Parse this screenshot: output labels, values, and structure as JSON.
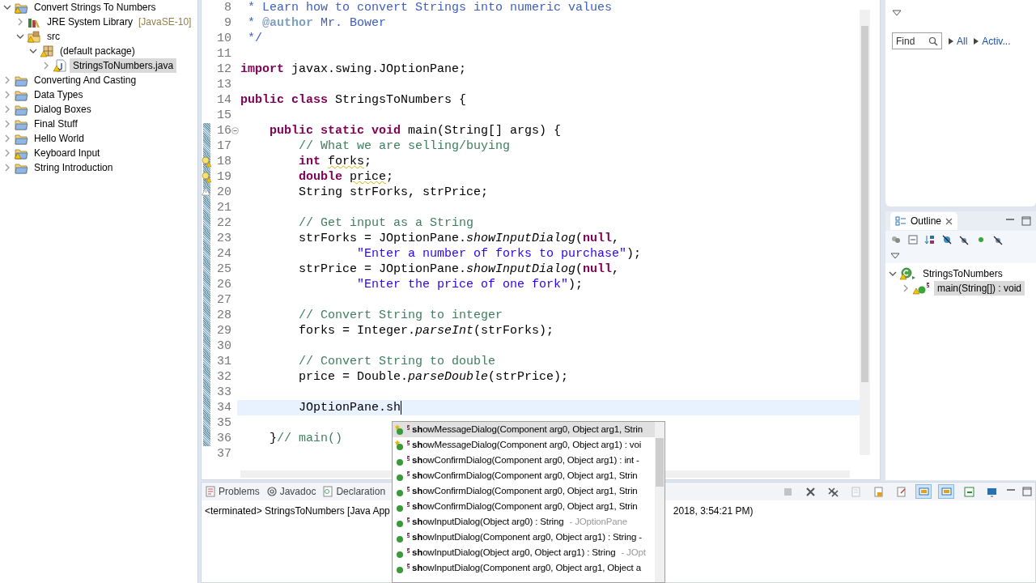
{
  "explorer": {
    "items": [
      {
        "label": "Convert Strings To Numbers",
        "kind": "project",
        "warning": true,
        "expanded": true,
        "selected": false,
        "children": [
          {
            "label": "JRE System Library",
            "decoration": "[JavaSE-10]",
            "kind": "library",
            "warning": false,
            "expanded": false,
            "selected": false
          },
          {
            "label": "src",
            "kind": "source-folder",
            "warning": true,
            "expanded": true,
            "selected": false,
            "children": [
              {
                "label": "(default package)",
                "kind": "package",
                "warning": true,
                "expanded": true,
                "selected": false,
                "children": [
                  {
                    "label": "StringsToNumbers.java",
                    "kind": "java-file",
                    "warning": true,
                    "expanded": false,
                    "selected": true
                  }
                ]
              }
            ]
          }
        ]
      },
      {
        "label": "Converting And Casting",
        "kind": "project",
        "warning": false,
        "expanded": false,
        "selected": false
      },
      {
        "label": "Data Types",
        "kind": "project",
        "warning": false,
        "expanded": false,
        "selected": false
      },
      {
        "label": "Dialog Boxes",
        "kind": "project",
        "warning": false,
        "expanded": false,
        "selected": false
      },
      {
        "label": "Final Stuff",
        "kind": "project",
        "warning": false,
        "expanded": false,
        "selected": false
      },
      {
        "label": "Hello World",
        "kind": "project",
        "warning": false,
        "expanded": false,
        "selected": false
      },
      {
        "label": "Keyboard Input",
        "kind": "project",
        "warning": true,
        "expanded": false,
        "selected": false
      },
      {
        "label": "String Introduction",
        "kind": "project",
        "warning": false,
        "expanded": false,
        "selected": false
      }
    ]
  },
  "editor": {
    "lines": [
      {
        "number": "8",
        "changed": false,
        "current": false,
        "tokens": [
          {
            "text": " * Learn how to convert Strings into numeric values",
            "kind": "javadoc"
          }
        ]
      },
      {
        "number": "9",
        "changed": false,
        "current": false,
        "tokens": [
          {
            "text": " * ",
            "kind": "javadoc"
          },
          {
            "text": "@author",
            "kind": "tag"
          },
          {
            "text": " Mr. Bower",
            "kind": "javadoc"
          }
        ]
      },
      {
        "number": "10",
        "changed": false,
        "current": false,
        "tokens": [
          {
            "text": " */",
            "kind": "javadoc"
          }
        ]
      },
      {
        "number": "11",
        "changed": false,
        "current": false
      },
      {
        "number": "12",
        "changed": false,
        "current": false,
        "tokens": [
          {
            "text": "import",
            "kind": "keyword"
          },
          {
            "text": " javax.swing.JOptionPane;",
            "kind": "plain"
          }
        ]
      },
      {
        "number": "13",
        "changed": false,
        "current": false
      },
      {
        "number": "14",
        "changed": false,
        "current": false,
        "tokens": [
          {
            "text": "public class",
            "kind": "keyword"
          },
          {
            "text": " StringsToNumbers {",
            "kind": "plain"
          }
        ]
      },
      {
        "number": "15",
        "changed": false,
        "current": false
      },
      {
        "number": "16",
        "changed": true,
        "current": false,
        "foldable": true,
        "tokens": [
          {
            "text": "    public static void",
            "kind": "keyword"
          },
          {
            "text": " main(String[] args) {",
            "kind": "plain"
          }
        ]
      },
      {
        "number": "17",
        "changed": true,
        "current": false,
        "tokens": [
          {
            "text": "        // What we are selling/buying",
            "kind": "comment"
          }
        ]
      },
      {
        "number": "18",
        "changed": true,
        "current": false,
        "quick_fix": true,
        "warning": true,
        "tokens": [
          {
            "text": "        int ",
            "kind": "keyword"
          },
          {
            "text": "forks",
            "kind": "warning"
          },
          {
            "text": ";",
            "kind": "plain"
          }
        ]
      },
      {
        "number": "19",
        "changed": true,
        "current": false,
        "quick_fix": true,
        "warning": true,
        "tokens": [
          {
            "text": "        double ",
            "kind": "keyword"
          },
          {
            "text": "price",
            "kind": "warning"
          },
          {
            "text": ";",
            "kind": "plain"
          }
        ]
      },
      {
        "number": "20",
        "changed": true,
        "current": false,
        "quick_fix": false,
        "warning": true,
        "tokens": [
          {
            "text": "        String strForks, strPrice;",
            "kind": "plain"
          }
        ]
      },
      {
        "number": "21",
        "changed": true,
        "current": false
      },
      {
        "number": "22",
        "changed": true,
        "current": false,
        "tokens": [
          {
            "text": "        // Get input as a String",
            "kind": "comment"
          }
        ]
      },
      {
        "number": "23",
        "changed": true,
        "current": false,
        "tokens": [
          {
            "text": "        strForks = JOptionPane.",
            "kind": "plain"
          },
          {
            "text": "showInputDialog",
            "kind": "static-call"
          },
          {
            "text": "(",
            "kind": "plain"
          },
          {
            "text": "null",
            "kind": "keyword"
          },
          {
            "text": ",",
            "kind": "plain"
          }
        ]
      },
      {
        "number": "24",
        "changed": true,
        "current": false,
        "tokens": [
          {
            "text": "                \"Enter a number of forks to purchase\"",
            "kind": "string"
          },
          {
            "text": ");",
            "kind": "plain"
          }
        ]
      },
      {
        "number": "25",
        "changed": true,
        "current": false,
        "tokens": [
          {
            "text": "        strPrice = JOptionPane.",
            "kind": "plain"
          },
          {
            "text": "showInputDialog",
            "kind": "static-call"
          },
          {
            "text": "(",
            "kind": "plain"
          },
          {
            "text": "null",
            "kind": "keyword"
          },
          {
            "text": ",",
            "kind": "plain"
          }
        ]
      },
      {
        "number": "26",
        "changed": true,
        "current": false,
        "tokens": [
          {
            "text": "                \"Enter the price of one fork\"",
            "kind": "string"
          },
          {
            "text": ");",
            "kind": "plain"
          }
        ]
      },
      {
        "number": "27",
        "changed": true,
        "current": false
      },
      {
        "number": "28",
        "changed": true,
        "current": false,
        "tokens": [
          {
            "text": "        // Convert String to integer",
            "kind": "comment"
          }
        ]
      },
      {
        "number": "29",
        "changed": true,
        "current": false,
        "tokens": [
          {
            "text": "        forks = Integer.",
            "kind": "plain"
          },
          {
            "text": "parseInt",
            "kind": "static-call"
          },
          {
            "text": "(strForks);",
            "kind": "plain"
          }
        ]
      },
      {
        "number": "30",
        "changed": true,
        "current": false
      },
      {
        "number": "31",
        "changed": true,
        "current": false,
        "tokens": [
          {
            "text": "        // Convert String to double",
            "kind": "comment"
          }
        ]
      },
      {
        "number": "32",
        "changed": true,
        "current": false,
        "tokens": [
          {
            "text": "        price = Double.",
            "kind": "plain"
          },
          {
            "text": "parseDouble",
            "kind": "static-call"
          },
          {
            "text": "(strPrice);",
            "kind": "plain"
          }
        ]
      },
      {
        "number": "33",
        "changed": true,
        "current": false
      },
      {
        "number": "34",
        "changed": true,
        "current": true,
        "caret": true,
        "tokens": [
          {
            "text": "        JOptionPane.sh",
            "kind": "plain"
          }
        ]
      },
      {
        "number": "35",
        "changed": true,
        "current": false
      },
      {
        "number": "36",
        "changed": true,
        "current": false,
        "tokens": [
          {
            "text": "    }",
            "kind": "plain"
          },
          {
            "text": "// main()",
            "kind": "comment"
          }
        ]
      },
      {
        "number": "37",
        "changed": false,
        "current": false
      }
    ]
  },
  "completion": {
    "items": [
      {
        "kind": "recent",
        "label": "**sh**owMessageDialog(Component arg0, Object arg1, Strin",
        "selected": true
      },
      {
        "kind": "recent",
        "label": "**sh**owMessageDialog(Component arg0, Object arg1) : voi",
        "selected": false
      },
      {
        "kind": "method",
        "label": "**sh**owConfirmDialog(Component arg0, Object arg1) : int -",
        "selected": false
      },
      {
        "kind": "method",
        "label": "**sh**owConfirmDialog(Component arg0, Object arg1, Strin",
        "selected": false
      },
      {
        "kind": "method",
        "label": "**sh**owConfirmDialog(Component arg0, Object arg1, Strin",
        "selected": false
      },
      {
        "kind": "method",
        "label": "**sh**owConfirmDialog(Component arg0, Object arg1, Strin",
        "selected": false
      },
      {
        "kind": "method",
        "label": "**sh**owInputDialog(Object arg0) : String",
        "qualifier": "- JOptionPane",
        "selected": false
      },
      {
        "kind": "method",
        "label": "**sh**owInputDialog(Component arg0, Object arg1) : String -",
        "selected": false
      },
      {
        "kind": "method",
        "label": "**sh**owInputDialog(Object arg0, Object arg1) : String",
        "qualifier": "- JOpt",
        "selected": false
      },
      {
        "kind": "method",
        "label": "**sh**owInputDialog(Component arg0, Object arg1, Object a",
        "selected": false
      }
    ]
  },
  "task_panel": {
    "find": {
      "placeholder": "Find"
    },
    "filters": [
      "All",
      "Activ..."
    ]
  },
  "outline": {
    "title": "Outline",
    "items": [
      {
        "label": "StringsToNumbers",
        "kind": "class",
        "expanded": true,
        "selected": false,
        "children": [
          {
            "label": "main(String[]) : void",
            "kind": "static-method",
            "expanded": false,
            "selected": true
          }
        ]
      }
    ]
  },
  "console": {
    "tabs": [
      {
        "label": "Problems",
        "kind": "problems"
      },
      {
        "label": "Javadoc",
        "kind": "javadoc"
      },
      {
        "label": "Declaration",
        "kind": "declaration"
      }
    ],
    "status_start": "<terminated> StringsToNumbers [Java App",
    "status_end": "2018, 3:54:21 PM)",
    "toolbar": [
      {
        "kind": "stop",
        "disabled": true,
        "pressed": false
      },
      {
        "kind": "remove",
        "disabled": false,
        "pressed": false
      },
      {
        "kind": "remove-all",
        "disabled": false,
        "pressed": false
      },
      {
        "kind": "sheet",
        "disabled": true,
        "pressed": false
      },
      {
        "kind": "lock-sheet",
        "disabled": false,
        "pressed": false
      },
      {
        "kind": "pin-sheet",
        "disabled": false,
        "pressed": false
      },
      {
        "kind": "screen",
        "disabled": false,
        "pressed": true
      },
      {
        "kind": "screen",
        "disabled": false,
        "pressed": true
      },
      {
        "kind": "open",
        "disabled": false,
        "pressed": false
      },
      {
        "kind": "monitor",
        "disabled": false,
        "pressed": false
      }
    ]
  }
}
